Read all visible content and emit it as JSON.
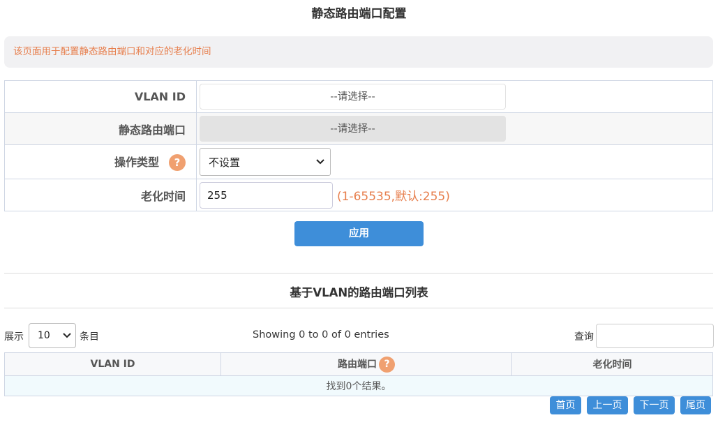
{
  "page": {
    "title": "静态路由端口配置",
    "notice": "该页面用于配置静态路由端口和对应的老化时间"
  },
  "form": {
    "vlan_id": {
      "label": "VLAN ID",
      "placeholder": "--请选择--"
    },
    "static_port": {
      "label": "静态路由端口",
      "placeholder": "--请选择--"
    },
    "op_type": {
      "label": "操作类型",
      "value": "不设置",
      "help": "?"
    },
    "age_time": {
      "label": "老化时间",
      "value": "255",
      "hint": "(1-65535,默认:255)"
    },
    "apply_label": "应用"
  },
  "list": {
    "title": "基于VLAN的路由端口列表",
    "show_label": "展示",
    "page_length": "10",
    "entries_label": "条目",
    "info": "Showing 0 to 0 of 0 entries",
    "search_label": "查询",
    "columns": [
      "VLAN ID",
      "路由端口",
      "老化时间"
    ],
    "help": "?",
    "empty": "找到0个结果。"
  },
  "pagination": {
    "first": "首页",
    "prev": "上一页",
    "next": "下一页",
    "last": "尾页"
  },
  "colors": {
    "accent": "#3e8ed9",
    "warning_text": "#e77e4c",
    "help_icon": "#f0a070"
  }
}
